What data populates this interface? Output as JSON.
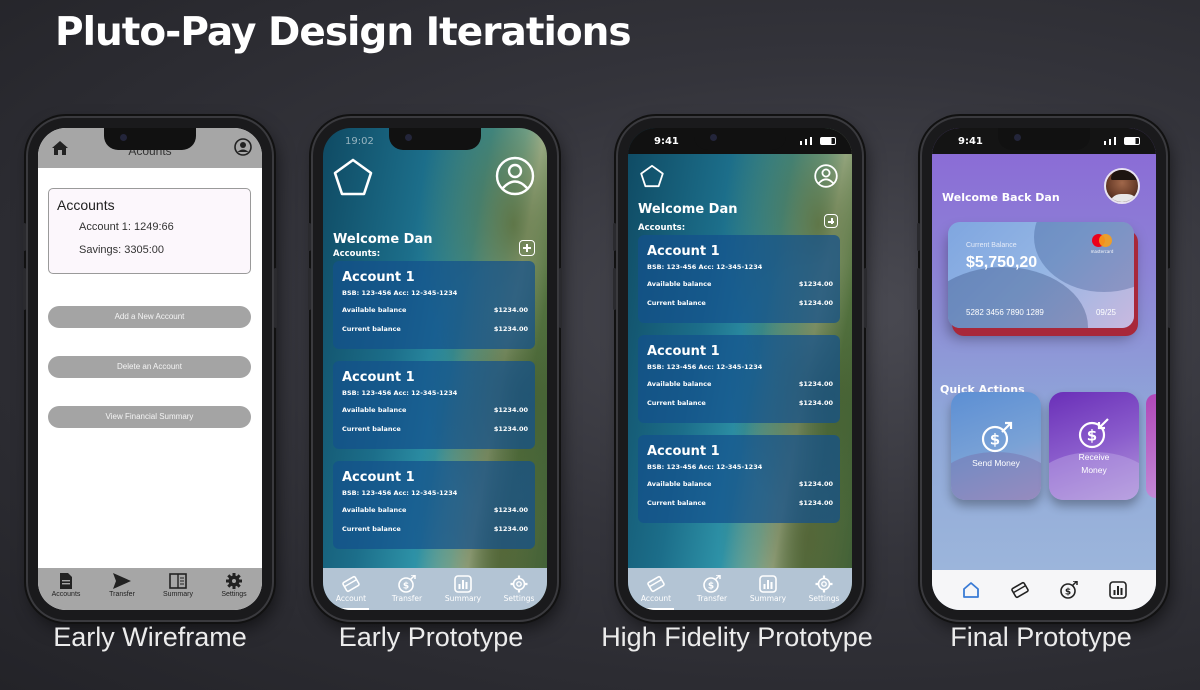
{
  "title": "Pluto-Pay Design Iterations",
  "captions": {
    "wireframe": "Early Wireframe",
    "early": "Early Prototype",
    "hifi": "High Fidelity Prototype",
    "final": "Final Prototype"
  },
  "wireframe": {
    "header_title": "Acounts",
    "card_title": "Accounts",
    "line1": "Account 1: 1249:66",
    "line2": "Savings: 3305:00",
    "buttons": [
      "Add a New Account",
      "Delete an Account",
      "View Financial Summary"
    ],
    "nav": [
      "Accounts",
      "Transfer",
      "Summary",
      "Settings"
    ]
  },
  "early": {
    "status_time": "19:02",
    "welcome": "Welcome Dan",
    "accounts_label": "Accounts:",
    "nav": [
      "Account",
      "Transfer",
      "Summary",
      "Settings"
    ]
  },
  "hifi": {
    "status_time": "9:41",
    "welcome": "Welcome Dan",
    "accounts_label": "Accounts:",
    "nav": [
      "Account",
      "Transfer",
      "Summary",
      "Settings"
    ]
  },
  "account_card": {
    "name": "Account 1",
    "bsb": "BSB: 123-456 Acc: 12-345-1234",
    "available_label": "Available balance",
    "available_value": "$1234.00",
    "current_label": "Current balance",
    "current_value": "$1234.00"
  },
  "final": {
    "status_time": "9:41",
    "welcome": "Welcome Back Dan",
    "card_label": "Current Balance",
    "card_balance": "$5,750,20",
    "card_number": "5282 3456 7890 1289",
    "card_expiry": "09/25",
    "card_brand": "mastercard",
    "quick_actions": "Quick Actions",
    "send_money": "Send Money",
    "receive_money_1": "Receive",
    "receive_money_2": "Money"
  },
  "colors": {
    "final_active_nav": "#3a7bd5",
    "card_shadow_red": "#a8283a",
    "glass_blue": "#14508c"
  },
  "icons": [
    "home-icon",
    "user-icon",
    "document-icon",
    "send-icon",
    "summary-icon",
    "gear-icon",
    "pentagon-icon",
    "plus-icon",
    "dollar-arrow-icon",
    "chart-icon",
    "card-icon"
  ]
}
